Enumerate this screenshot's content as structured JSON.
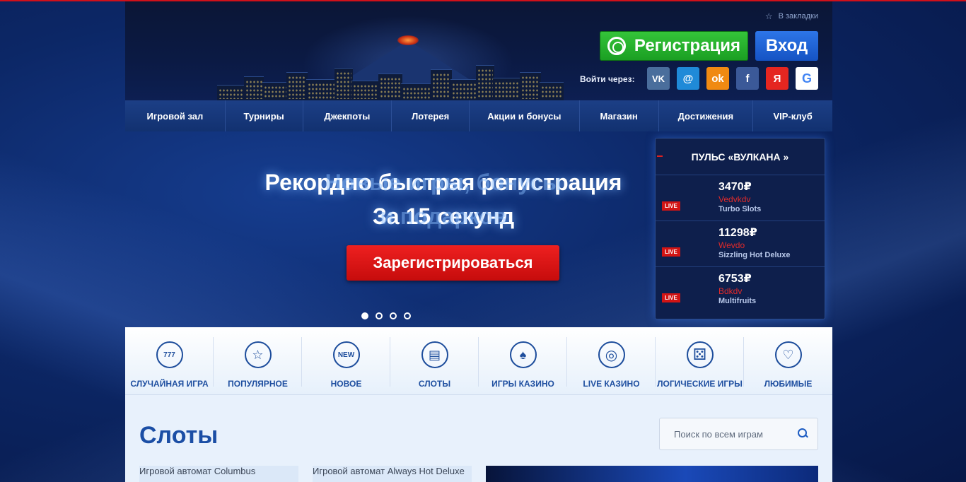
{
  "header": {
    "bookmark_label": "В закладки",
    "register_label": "Регистрация",
    "login_label": "Вход",
    "login_via_label": "Войти через:",
    "social": [
      {
        "name": "vk",
        "glyph": "VK",
        "color": "#4a6e9c"
      },
      {
        "name": "mail",
        "glyph": "@",
        "color": "#1f8ad8"
      },
      {
        "name": "odnoklassniki",
        "glyph": "ok",
        "color": "#f08a12"
      },
      {
        "name": "facebook",
        "glyph": "f",
        "color": "#3b5998"
      },
      {
        "name": "yandex",
        "glyph": "Я",
        "color": "#e52620"
      },
      {
        "name": "google",
        "glyph": "G",
        "color": "#ffffff"
      }
    ]
  },
  "nav": {
    "items": [
      "Игровой зал",
      "Турниры",
      "Джекпоты",
      "Лотерея",
      "Акции и бонусы",
      "Магазин",
      "Достижения",
      "VIP-клуб"
    ]
  },
  "hero": {
    "title_line1": "Рекордно быстрая регистрация",
    "title_line2": "За 15 секунд",
    "ghost_line1": "Новые игры, бонусы",
    "ghost_line2": "и подарков",
    "cta_label": "Зарегистрироваться",
    "slides_count": 4,
    "active_slide": 1
  },
  "pulse": {
    "title": "ПУЛЬС «ВУЛКАНА »",
    "live_label": "LIVE",
    "rows": [
      {
        "amount": "3470₽",
        "user": "Vedvkdv",
        "game": "Turbo Slots"
      },
      {
        "amount": "11298₽",
        "user": "Wevdo",
        "game": "Sizzling Hot Deluxe"
      },
      {
        "amount": "6753₽",
        "user": "Bdkdv",
        "game": "Multifruits"
      }
    ]
  },
  "categories": [
    {
      "label": "СЛУЧАЙНАЯ ИГРА",
      "icon": "slot-777-icon",
      "glyph": "777"
    },
    {
      "label": "ПОПУЛЯРНОЕ",
      "icon": "star-icon",
      "glyph": "☆"
    },
    {
      "label": "НОВОЕ",
      "icon": "new-icon",
      "glyph": "NEW"
    },
    {
      "label": "СЛОТЫ",
      "icon": "slot-machine-icon",
      "glyph": "▤"
    },
    {
      "label": "ИГРЫ КАЗИНО",
      "icon": "cards-icon",
      "glyph": "♠"
    },
    {
      "label": "LIVE КАЗИНО",
      "icon": "chip-icon",
      "glyph": "◎"
    },
    {
      "label": "ЛОГИЧЕСКИЕ ИГРЫ",
      "icon": "dice-icon",
      "glyph": "⚄"
    },
    {
      "label": "ЛЮБИМЫЕ",
      "icon": "heart-icon",
      "glyph": "♡"
    }
  ],
  "content": {
    "section_title": "Слоты",
    "search_placeholder": "Поиск по всем играм",
    "games": [
      "Игровой автомат Columbus",
      "Игровой автомат Always Hot Deluxe"
    ]
  },
  "colors": {
    "accent_red": "#d0101a",
    "register_green": "#1a9e22",
    "login_blue": "#1553c3",
    "category_blue": "#1f4fa0"
  }
}
